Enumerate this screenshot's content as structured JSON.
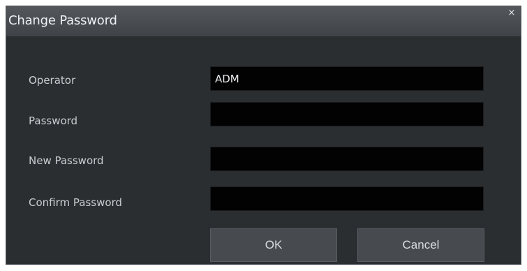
{
  "dialog": {
    "title": "Change Password",
    "close_glyph": "×"
  },
  "fields": {
    "operator": {
      "label": "Operator",
      "value": "ADM"
    },
    "password": {
      "label": "Password",
      "value": ""
    },
    "new_password": {
      "label": "New Password",
      "value": ""
    },
    "confirm_password": {
      "label": "Confirm Password",
      "value": ""
    }
  },
  "buttons": {
    "ok": "OK",
    "cancel": "Cancel"
  }
}
